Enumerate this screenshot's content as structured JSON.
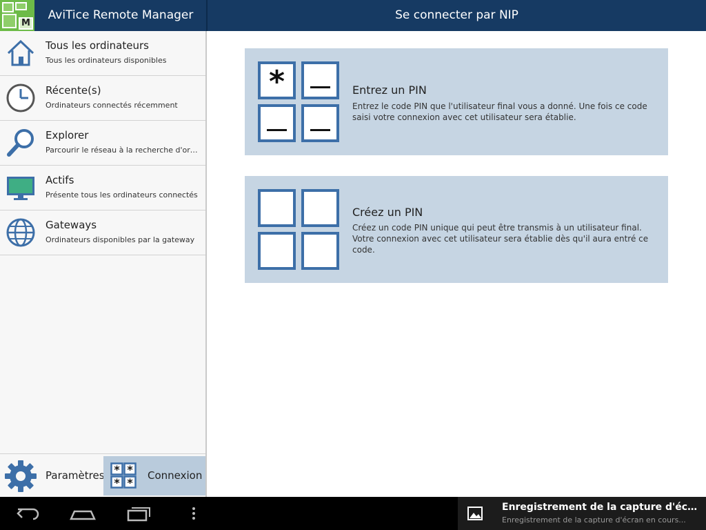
{
  "header": {
    "app_title": "AviTice Remote Manager",
    "page_title": "Se connecter par NIP",
    "logo_letter": "M"
  },
  "sidebar": {
    "items": [
      {
        "label": "Tous les ordinateurs",
        "sub": "Tous les ordinateurs disponibles",
        "icon": "home-icon"
      },
      {
        "label": "Récente(s)",
        "sub": "Ordinateurs connectés récemment",
        "icon": "clock-icon"
      },
      {
        "label": "Explorer",
        "sub": "Parcourir le réseau à la recherche d'ordinateurs",
        "icon": "search-icon"
      },
      {
        "label": "Actifs",
        "sub": "Présente tous les ordinateurs connectés",
        "icon": "monitor-icon"
      },
      {
        "label": "Gateways",
        "sub": "Ordinateurs disponibles par la gateway",
        "icon": "globe-icon"
      }
    ],
    "settings_label": "Paramètres",
    "connect_label": "Connexion"
  },
  "main": {
    "cards": [
      {
        "title": "Entrez un PIN",
        "desc": "Entrez le code PIN que l'utilisateur final vous a donné. Une fois ce code saisi votre connexion avec cet utilisateur sera établie."
      },
      {
        "title": "Créez un PIN",
        "desc": "Créez un code PIN unique qui peut être transmis à un utilisateur final. Votre connexion avec cet utilisateur sera établie dès qu'il aura entré ce code."
      }
    ]
  },
  "notification": {
    "title": "Enregistrement de la capture d'écran...",
    "subtitle": "Enregistrement de la capture d'écran en cours..."
  },
  "colors": {
    "header_bg": "#163a63",
    "card_bg": "#c6d5e3",
    "icon_blue": "#3d6fa8",
    "active_bg": "#b9cbdc"
  }
}
